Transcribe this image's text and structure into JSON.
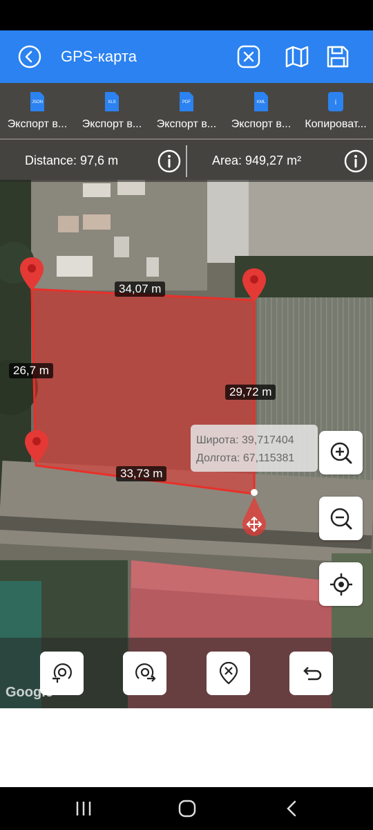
{
  "app_bar": {
    "title": "GPS-карта",
    "back_icon": "back-arrow-circle-icon",
    "clear_icon": "close-box-icon",
    "map_icon": "map-icon",
    "save_icon": "save-floppy-icon"
  },
  "export_bar": {
    "items": [
      {
        "format": "JSON",
        "label": "Экспорт в..."
      },
      {
        "format": "XLS",
        "label": "Экспорт в..."
      },
      {
        "format": "PDF",
        "label": "Экспорт в..."
      },
      {
        "format": "KML",
        "label": "Экспорт в..."
      },
      {
        "format": "i",
        "label": "Копироват..."
      }
    ]
  },
  "measure": {
    "distance": "Distance: 97,6 m",
    "area": "Area: 949,27 m²"
  },
  "segments": {
    "top": "34,07 m",
    "left": "26,7 m",
    "right": "29,72 m",
    "bottom": "33,73 m"
  },
  "coordinates": {
    "latitude": "Широта: 39,717404",
    "longitude": "Долгота: 67,115381"
  },
  "map": {
    "attribution": "Google",
    "polygon_color": "#e8302a",
    "accent_color": "#2b82f0"
  },
  "actions": {
    "undo_rotate_icon": "rotate-left-pin-icon",
    "redo_rotate_icon": "rotate-right-pin-icon",
    "delete_point_icon": "delete-pin-icon",
    "undo_icon": "undo-arrow-icon"
  }
}
